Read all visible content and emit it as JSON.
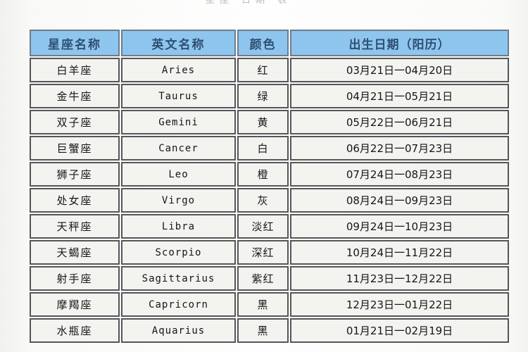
{
  "page": {
    "top_ghost_text": "星座  日期  表"
  },
  "table": {
    "columns": [
      {
        "key": "name",
        "label": "星座名称"
      },
      {
        "key": "eng",
        "label": "英文名称"
      },
      {
        "key": "color",
        "label": "颜色"
      },
      {
        "key": "date",
        "label": "出生日期（阳历）"
      }
    ],
    "rows": [
      {
        "name": "白羊座",
        "eng": "Aries",
        "color": "红",
        "date": "03月21日一04月20日"
      },
      {
        "name": "金牛座",
        "eng": "Taurus",
        "color": "绿",
        "date": "04月21日一05月21日"
      },
      {
        "name": "双子座",
        "eng": "Gemini",
        "color": "黄",
        "date": "05月22日一06月21日"
      },
      {
        "name": "巨蟹座",
        "eng": "Cancer",
        "color": "白",
        "date": "06月22日一07月23日"
      },
      {
        "name": "狮子座",
        "eng": "Leo",
        "color": "橙",
        "date": "07月24日一08月23日"
      },
      {
        "name": "处女座",
        "eng": "Virgo",
        "color": "灰",
        "date": "08月24日一09月23日"
      },
      {
        "name": "天秤座",
        "eng": "Libra",
        "color": "淡红",
        "date": "09月24日一10月23日"
      },
      {
        "name": "天蝎座",
        "eng": "Scorpio",
        "color": "深红",
        "date": "10月24日一11月22日"
      },
      {
        "name": "射手座",
        "eng": "Sagittarius",
        "color": "紫红",
        "date": "11月23日一12月22日"
      },
      {
        "name": "摩羯座",
        "eng": "Capricorn",
        "color": "黑",
        "date": "12月23日一01月22日"
      },
      {
        "name": "水瓶座",
        "eng": "Aquarius",
        "color": "黑",
        "date": "01月21日一02月19日"
      }
    ]
  },
  "colors": {
    "header_fill": "#8fc6ef",
    "header_text": "#2f4f73",
    "header_border": "#6c7d8c",
    "cell_fill": "#f4f4f0",
    "cell_border": "#56565a",
    "cell_text": "#15151a",
    "page_background": "#ffffff"
  }
}
